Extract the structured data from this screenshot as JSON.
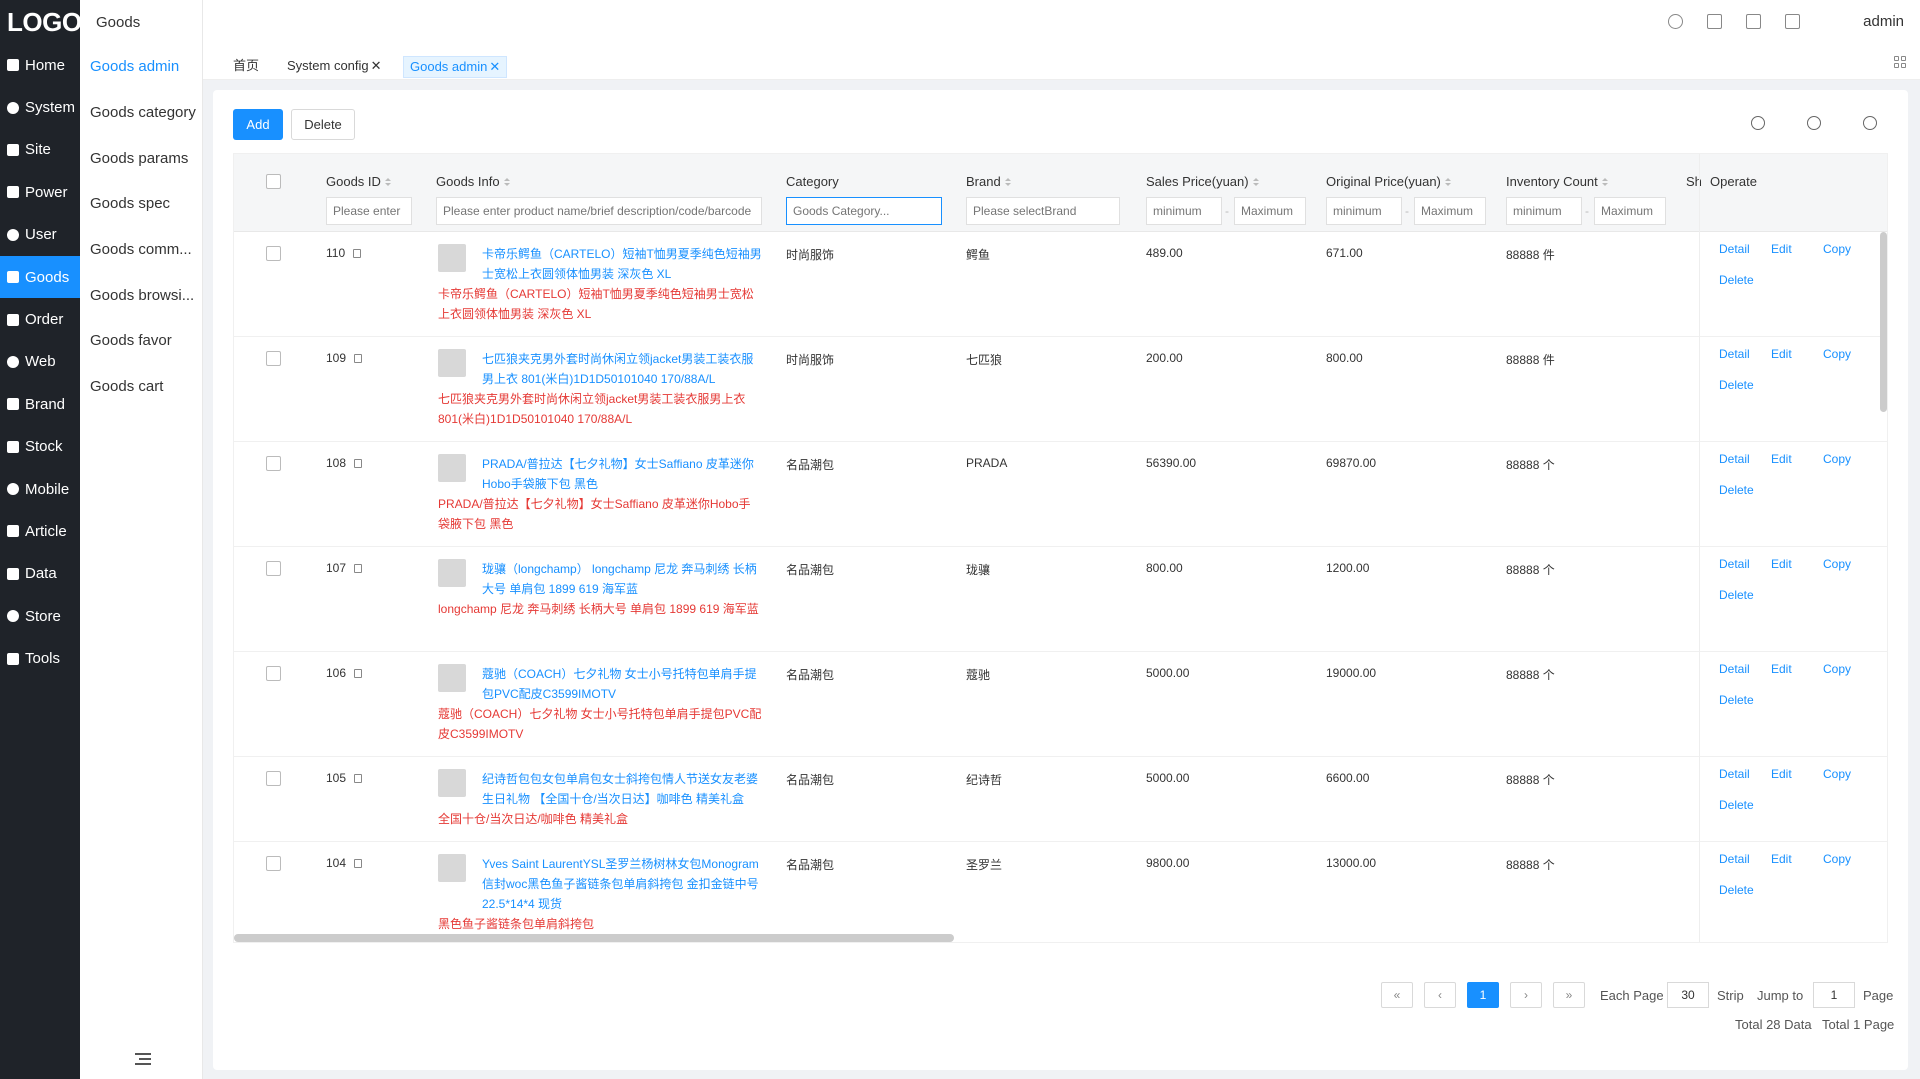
{
  "brand": {
    "logo": "LOGO"
  },
  "nav": [
    {
      "label": "Home",
      "icon": "home-icon"
    },
    {
      "label": "System",
      "icon": "gear-icon"
    },
    {
      "label": "Site",
      "icon": "bookmark-icon"
    },
    {
      "label": "Power",
      "icon": "user-lock-icon"
    },
    {
      "label": "User",
      "icon": "user-icon"
    },
    {
      "label": "Goods",
      "icon": "package-icon",
      "active": true
    },
    {
      "label": "Order",
      "icon": "order-icon"
    },
    {
      "label": "Web",
      "icon": "monitor-icon"
    },
    {
      "label": "Brand",
      "icon": "brand-icon"
    },
    {
      "label": "Stock",
      "icon": "warehouse-icon"
    },
    {
      "label": "Mobile",
      "icon": "mobile-icon"
    },
    {
      "label": "Article",
      "icon": "article-icon"
    },
    {
      "label": "Data",
      "icon": "bar-chart-icon"
    },
    {
      "label": "Store",
      "icon": "store-icon"
    },
    {
      "label": "Tools",
      "icon": "wrench-icon"
    }
  ],
  "subnav": {
    "title": "Goods",
    "items": [
      "Goods admin",
      "Goods category",
      "Goods params",
      "Goods spec",
      "Goods comm...",
      "Goods browsi...",
      "Goods favor",
      "Goods cart"
    ]
  },
  "header": {
    "user": "admin"
  },
  "tabs": [
    {
      "label": "首页"
    },
    {
      "label": "System config",
      "close": "✕"
    },
    {
      "label": "Goods admin",
      "close": "✕",
      "active": true
    }
  ],
  "toolbar": {
    "add": "Add",
    "delete": "Delete"
  },
  "table": {
    "headers": {
      "id": "Goods ID",
      "info": "Goods Info",
      "category": "Category",
      "brand": "Brand",
      "sales": "Sales Price(yuan)",
      "original": "Original Price(yuan)",
      "inventory": "Inventory Count",
      "sh": "Sh",
      "operate": "Operate"
    },
    "filters": {
      "id": "Please enter",
      "info": "Please enter product name/brief description/code/barcode",
      "category": "Goods Category...",
      "brand": "Please selectBrand",
      "min": "minimum",
      "max": "Maximum",
      "dash": "-"
    },
    "ops": {
      "detail": "Detail",
      "edit": "Edit",
      "copy": "Copy",
      "delete": "Delete"
    },
    "rows": [
      {
        "id": "110",
        "title": "卡帝乐鳄鱼（CARTELO）短袖T恤男夏季纯色短袖男士宽松上衣圆领体恤男装 深灰色 XL",
        "desc": "卡帝乐鳄鱼（CARTELO）短袖T恤男夏季纯色短袖男士宽松上衣圆领体恤男装 深灰色 XL",
        "category": "时尚服饰",
        "brand": "鳄鱼",
        "sales": "489.00",
        "original": "671.00",
        "inventory": "88888 件"
      },
      {
        "id": "109",
        "title": "七匹狼夹克男外套时尚休闲立领jacket男装工装衣服男上衣 801(米白)1D1D50101040 170/88A/L",
        "desc": "七匹狼夹克男外套时尚休闲立领jacket男装工装衣服男上衣 801(米白)1D1D50101040 170/88A/L",
        "category": "时尚服饰",
        "brand": "七匹狼",
        "sales": "200.00",
        "original": "800.00",
        "inventory": "88888 件"
      },
      {
        "id": "108",
        "title": "PRADA/普拉达【七夕礼物】女士Saffiano 皮革迷你Hobo手袋腋下包 黑色",
        "desc": "PRADA/普拉达【七夕礼物】女士Saffiano 皮革迷你Hobo手袋腋下包 黑色",
        "category": "名品潮包",
        "brand": "PRADA",
        "sales": "56390.00",
        "original": "69870.00",
        "inventory": "88888 个"
      },
      {
        "id": "107",
        "title": "珑骧（longchamp） longchamp 尼龙 奔马刺绣 长柄大号 单肩包 1899 619 海军蓝",
        "desc": "longchamp 尼龙 奔马刺绣 长柄大号 单肩包 1899 619 海军蓝",
        "category": "名品潮包",
        "brand": "珑骧",
        "sales": "800.00",
        "original": "1200.00",
        "inventory": "88888 个"
      },
      {
        "id": "106",
        "title": "蔻驰（COACH）七夕礼物 女士小号托特包单肩手提包PVC配皮C3599IMOTV",
        "desc": "蔻驰（COACH）七夕礼物 女士小号托特包单肩手提包PVC配皮C3599IMOTV",
        "category": "名品潮包",
        "brand": "蔻驰",
        "sales": "5000.00",
        "original": "19000.00",
        "inventory": "88888 个"
      },
      {
        "id": "105",
        "title": "纪诗哲包包女包单肩包女士斜挎包情人节送女友老婆生日礼物 【全国十仓/当次日达】咖啡色 精美礼盒",
        "desc": "全国十仓/当次日达/咖啡色 精美礼盒",
        "category": "名品潮包",
        "brand": "纪诗哲",
        "sales": "5000.00",
        "original": "6600.00",
        "inventory": "88888 个"
      },
      {
        "id": "104",
        "title": "Yves Saint LaurentYSL圣罗兰杨树林女包Monogram信封woc黑色鱼子酱链条包单肩斜挎包 金扣金链中号22.5*14*4 现货",
        "desc": "黑色鱼子酱链条包单肩斜挎包",
        "category": "名品潮包",
        "brand": "圣罗兰",
        "sales": "9800.00",
        "original": "13000.00",
        "inventory": "88888 个"
      }
    ]
  },
  "pagination": {
    "first": "«",
    "prev": "‹",
    "current": "1",
    "next": "›",
    "last": "»",
    "each_page": "Each Page",
    "page_size": "30",
    "strip": "Strip",
    "jump_to": "Jump to",
    "jump_value": "1",
    "page": "Page",
    "total_data": "Total 28 Data",
    "total_pages": "Total 1 Page"
  },
  "colors": {
    "accent": "#1890ff",
    "sidebar": "#1f2329",
    "red_text": "#e53935"
  }
}
